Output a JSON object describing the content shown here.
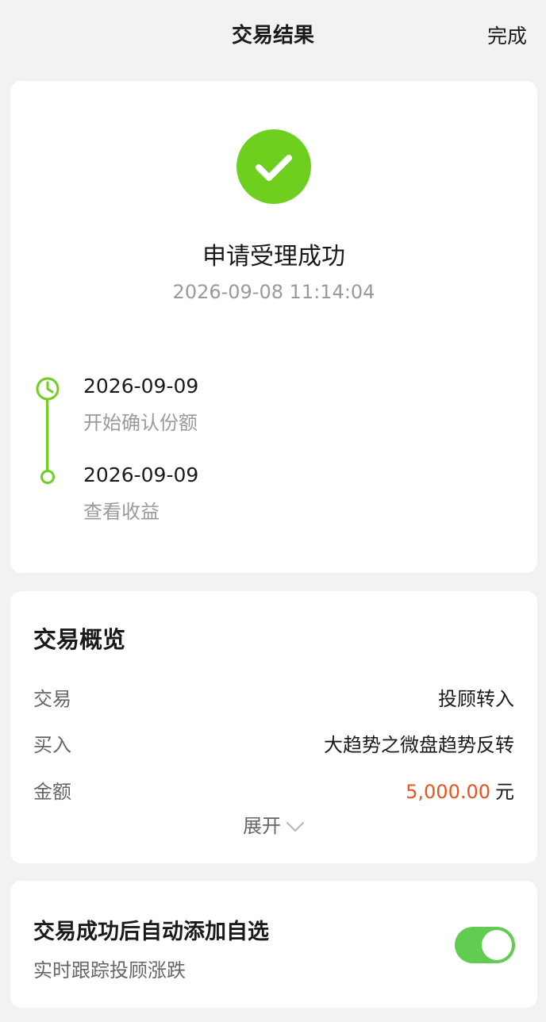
{
  "header": {
    "title": "交易结果",
    "done_label": "完成"
  },
  "status": {
    "title": "申请受理成功",
    "time": "2026-09-08 11:14:04",
    "icon": "check-circle-icon",
    "accent": "#6fcf1f"
  },
  "timeline": [
    {
      "date": "2026-09-09",
      "desc": "开始确认份额",
      "icon": "clock-icon"
    },
    {
      "date": "2026-09-09",
      "desc": "查看收益",
      "icon": "dot-icon"
    }
  ],
  "summary": {
    "title": "交易概览",
    "rows": [
      {
        "label": "交易",
        "value": "投顾转入"
      },
      {
        "label": "买入",
        "value": "大趋势之微盘趋势反转"
      },
      {
        "label": "金额",
        "value": "5,000.00",
        "unit": "元",
        "color": "#e8541c"
      }
    ],
    "expand_label": "展开",
    "expand_icon": "chevron-down-icon"
  },
  "auto_add": {
    "title": "交易成功后自动添加自选",
    "subtitle": "实时跟踪投顾涨跌",
    "enabled": true,
    "toggle_color": "#62cc52"
  }
}
